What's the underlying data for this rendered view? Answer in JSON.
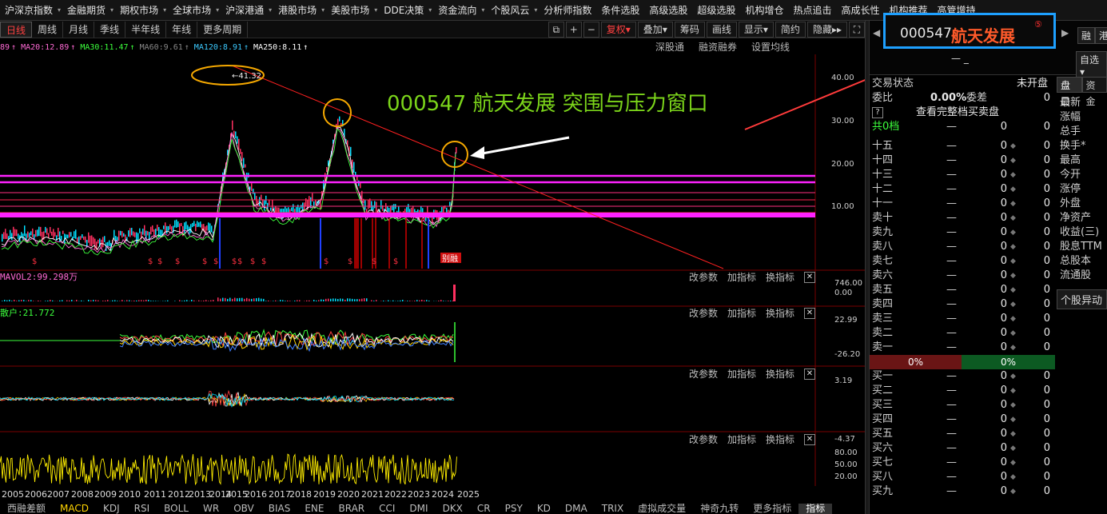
{
  "menu": [
    {
      "label": "沪深京指数",
      "dd": true
    },
    {
      "label": "金融期货",
      "dd": true
    },
    {
      "label": "期权市场",
      "dd": true
    },
    {
      "label": "全球市场",
      "dd": true
    },
    {
      "label": "沪深港通",
      "dd": true
    },
    {
      "label": "港股市场",
      "dd": true
    },
    {
      "label": "美股市场",
      "dd": true
    },
    {
      "label": "DDE决策",
      "dd": true
    },
    {
      "label": "资金流向",
      "dd": true
    },
    {
      "label": "个股风云",
      "dd": true
    },
    {
      "label": "分析师指数",
      "dd": false
    },
    {
      "label": "条件选股",
      "dd": false
    },
    {
      "label": "高级选股",
      "dd": false
    },
    {
      "label": "超级选股",
      "dd": false
    },
    {
      "label": "机构增仓",
      "dd": false
    },
    {
      "label": "热点追击",
      "dd": false
    },
    {
      "label": "高成长性",
      "dd": false
    },
    {
      "label": "机构推荐",
      "dd": false
    },
    {
      "label": "高管增持",
      "dd": false
    }
  ],
  "timeframes": [
    "日线",
    "周线",
    "月线",
    "季线",
    "半年线",
    "年线",
    "更多周期"
  ],
  "toolbar": {
    "fuquan": "复权",
    "overlay": "叠加",
    "chips": "筹码",
    "draw": "画线",
    "display": "显示",
    "simple": "简约",
    "hide": "隐藏"
  },
  "ma_values": [
    {
      "label": "89",
      "color": "#ff6ad5"
    },
    {
      "label": "MA20:12.89",
      "color": "#ff6ad5"
    },
    {
      "label": "MA30:11.47",
      "color": "#3cff3c"
    },
    {
      "label": "MA60:9.61",
      "color": "#888888"
    },
    {
      "label": "MA120:8.91",
      "color": "#3ccaff"
    },
    {
      "label": "MA250:8.11",
      "color": "#ffffff"
    }
  ],
  "sub_links": [
    "深股通",
    "融资融券",
    "设置均线"
  ],
  "annotation": {
    "high_label": "41.32",
    "title": "000547  航天发展 突围与压力窗口"
  },
  "price_axis": [
    "40.00",
    "30.00",
    "20.00",
    "10.00"
  ],
  "panels": [
    {
      "label": "MAVOL2:99.298万",
      "label_color": "#ff6ad5",
      "axis": [
        "746.00",
        "0.00"
      ]
    },
    {
      "label": "散户:21.772",
      "label_color": "#3cff3c",
      "axis": [
        "22.99",
        "-26.20"
      ]
    },
    {
      "label": "",
      "label_color": "#ccc",
      "axis": [
        "3.19",
        "-4.37"
      ]
    },
    {
      "label": "",
      "label_color": "#ccc",
      "axis": [
        "80.00",
        "50.00",
        "20.00"
      ]
    }
  ],
  "panel_tools": [
    "改参数",
    "加指标",
    "换指标"
  ],
  "event_marks": {
    "split_label": "别",
    "finance_label": "融"
  },
  "years": [
    "2005",
    "2006",
    "2007",
    "2008",
    "2009",
    "2010",
    "2011",
    "2012",
    "2013",
    "2014",
    "2015",
    "2016",
    "2017",
    "2018",
    "2019",
    "2020",
    "2021",
    "2022",
    "2023",
    "2024",
    "2025"
  ],
  "indicator_tabs": [
    "西融差额",
    "MACD",
    "KDJ",
    "RSI",
    "BOLL",
    "WR",
    "OBV",
    "BIAS",
    "ENE",
    "BRAR",
    "CCI",
    "DMI",
    "DKX",
    "CR",
    "PSY",
    "KD",
    "DMA",
    "TRIX",
    "虚拟成交量",
    "神奇九转",
    "更多指标",
    "指标"
  ],
  "stock": {
    "code": "000547",
    "name": "航天发展",
    "badge": "⑤",
    "side_top": "融",
    "side_top2": "港",
    "select": "自选",
    "dash": "— _"
  },
  "order_book": {
    "status_label": "交易状态",
    "status_value": "未开盘",
    "weibi_label": "委比",
    "weibi_value": "0.00%",
    "weicha_label": "委差",
    "weicha_value": "0",
    "full_label": "查看完整档买卖盘",
    "total_label": "共0档",
    "total_dash": "—",
    "total_v1": "0",
    "total_v2": "0",
    "levels_top": [
      "十五",
      "十四",
      "十三",
      "十二",
      "十一",
      "卖十",
      "卖九",
      "卖八",
      "卖七",
      "卖六",
      "卖五",
      "卖四",
      "卖三",
      "卖二",
      "卖一"
    ],
    "ratio_sell": "0%",
    "ratio_buy": "0%",
    "levels_bottom": [
      "买一",
      "买二",
      "买三",
      "买四",
      "买五",
      "买六",
      "买七",
      "买八",
      "买九"
    ],
    "dash": "—",
    "zero": "0"
  },
  "info": {
    "tabs": [
      "盘口",
      "资金"
    ],
    "items": [
      "最新",
      "涨幅",
      "总手",
      "换手*",
      "最高",
      "今开",
      "涨停",
      "外盘",
      "净资产",
      "收益(三)",
      "股息TTM",
      "总股本",
      "流通股"
    ],
    "button": "个股异动"
  }
}
